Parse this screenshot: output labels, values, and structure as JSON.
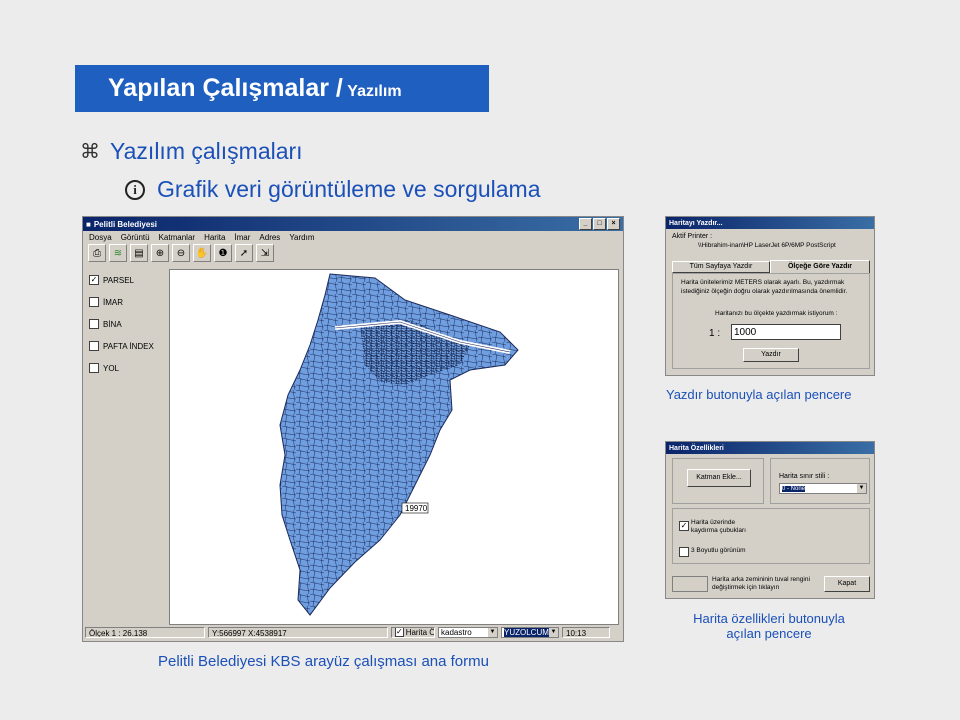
{
  "slide": {
    "title": "Yapılan Çalışmalar /",
    "title_sub": "Yazılım",
    "bullet1": "Yazılım çalışmaları",
    "bullet2": "Grafik veri görüntüleme ve sorgulama",
    "caption_main": "Pelitli Belediyesi KBS arayüz çalışması ana formu",
    "caption_print": "Yazdır butonuyla açılan pencere",
    "caption_props_1": "Harita özellikleri butonuyla",
    "caption_props_2": "açılan pencere"
  },
  "main_window": {
    "title": "Pelitli Belediyesi",
    "menu": [
      "Dosya",
      "Görüntü",
      "Katmanlar",
      "Harita",
      "İmar",
      "Adres",
      "Yardım"
    ],
    "toolbar_icons": [
      "printer-icon",
      "layers-icon",
      "table-icon",
      "zoom-in-icon",
      "zoom-out-icon",
      "pan-hand-icon",
      "info-icon",
      "select-arrow-icon",
      "export-icon"
    ],
    "layers": [
      {
        "label": "PARSEL",
        "checked": true
      },
      {
        "label": "İMAR",
        "checked": false
      },
      {
        "label": "BİNA",
        "checked": false
      },
      {
        "label": "PAFTA İNDEX",
        "checked": false
      },
      {
        "label": "YOL",
        "checked": false
      }
    ],
    "map_label": "19970",
    "status": {
      "scale": "Ölçek   1 : 26.138",
      "coords": "Y:566997 X:4538917",
      "map_props": "Harita Öz.",
      "combo1": "kadastro",
      "combo2": "YUZOLCUM",
      "time": "10:13"
    },
    "colors": {
      "map_fill": "#6f9fe0",
      "titlebar": "#0a246a"
    }
  },
  "print_dialog": {
    "title": "Haritayı Yazdır...",
    "printer_label": "Aktif Printer :",
    "printer_name": "\\\\Hibrahim-inan\\HP LaserJet 6P/6MP PostScript",
    "tab_all": "Tüm Sayfaya Yazdır",
    "tab_scale": "Ölçeğe Göre Yazdır",
    "info": "Harita ünitelerimiz METERS olarak ayarlı. Bu, yazdırmak istediğiniz ölçeğin doğru olarak yazdırılmasında önemlidir.",
    "scale_prompt": "Haritanızı bu ölçekte yazdırmak istiyorum :",
    "scale_prefix": "1 :",
    "scale_value": "1000",
    "print_button": "Yazdır"
  },
  "props_dialog": {
    "title": "Harita Özellikleri",
    "layer_button": "Katman Ekle...",
    "border_style_label": "Harita sınır stili :",
    "border_style_value": "0 - None",
    "scrollbars_label": "Harita üzerinde kaydırma çubukları",
    "scrollbars_checked": true,
    "view3d_label": "3 Boyutlu görünüm",
    "view3d_checked": false,
    "bgcolor_label": "Harita arka zemininin tuval rengini değiştirmek için tıklayın",
    "close_button": "Kapat"
  }
}
